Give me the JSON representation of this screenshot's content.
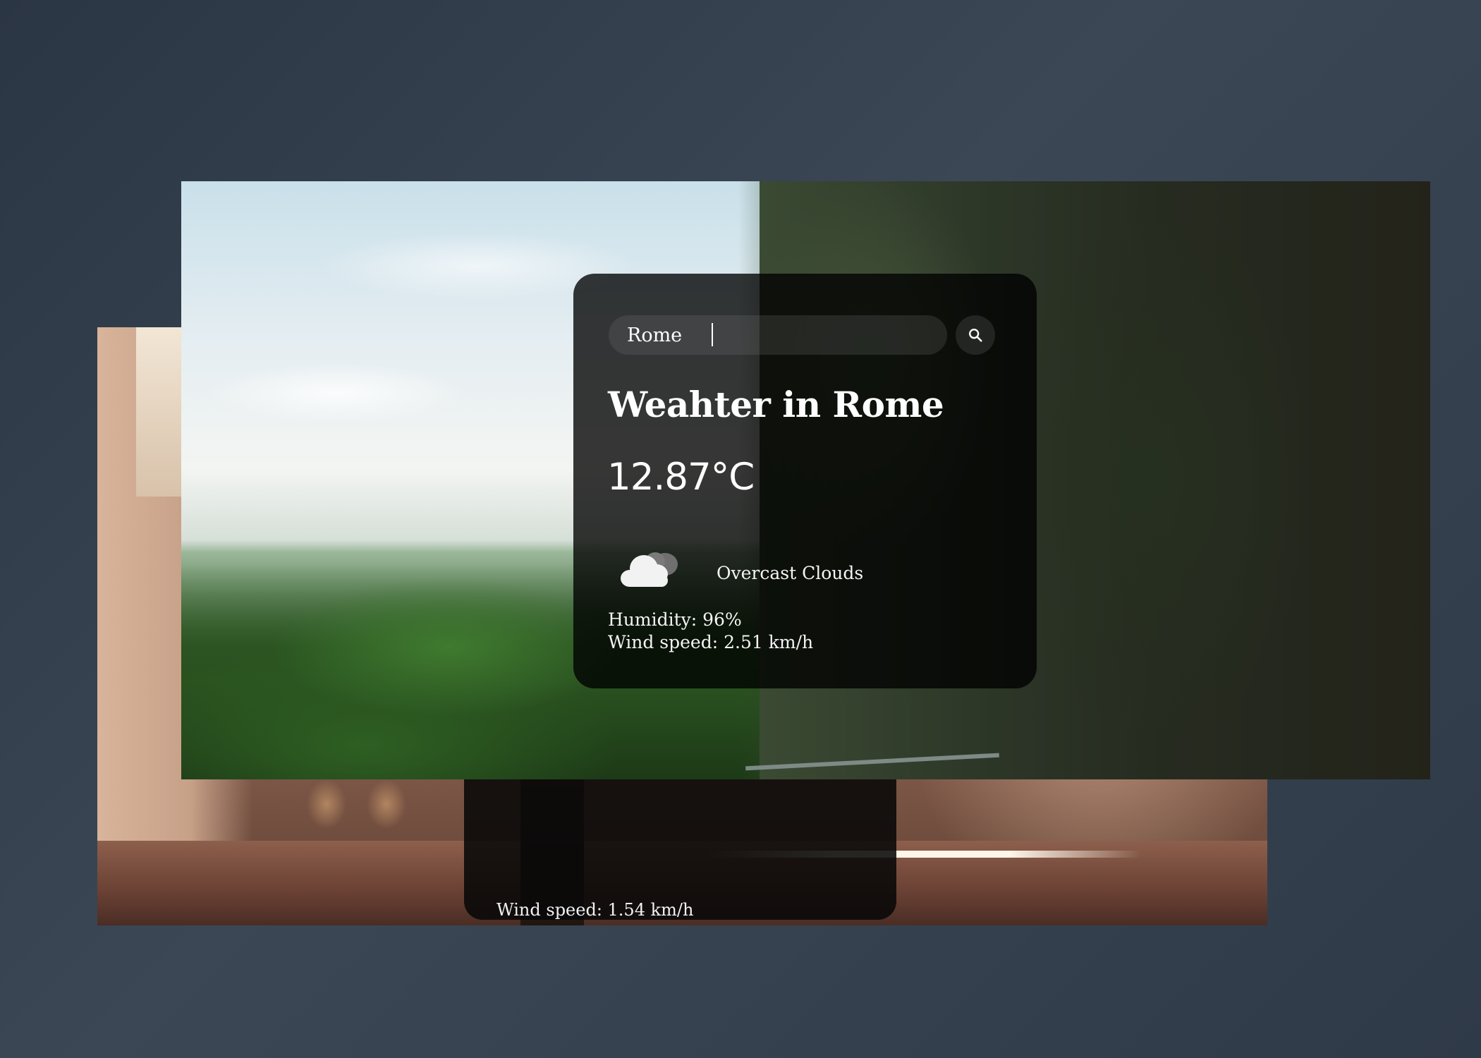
{
  "back_screen": {
    "wind_text": "Wind speed: 1.54 km/h"
  },
  "weather": {
    "search": {
      "value": "Rome",
      "placeholder": "Search"
    },
    "title": "Weahter in Rome",
    "temperature": "12.87°C",
    "condition": "Overcast Clouds",
    "condition_icon": "cloud-icon",
    "humidity": "Humidity: 96%",
    "wind": "Wind speed: 2.51 km/h"
  },
  "colors": {
    "background": "#333f4d",
    "card": "#000000",
    "text": "#ffffff"
  }
}
